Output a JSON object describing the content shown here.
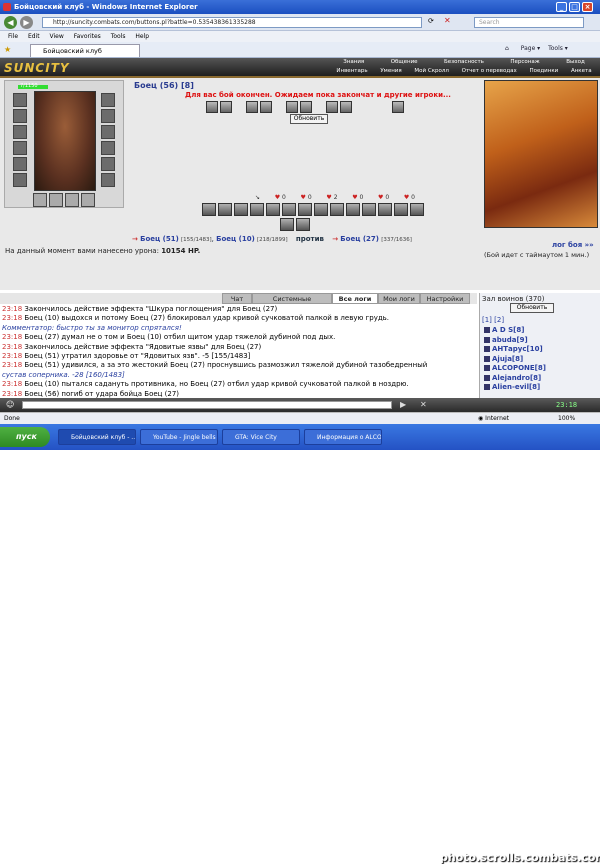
{
  "window": {
    "title": "Бойцовский клуб - Windows Internet Explorer",
    "min": "_",
    "max": "□",
    "close": "×"
  },
  "address": {
    "url": "http://suncity.combats.com/buttons.pl?battle=0.535438361335288",
    "search_placeholder": "Search"
  },
  "menu": [
    "File",
    "Edit",
    "View",
    "Favorites",
    "Tools",
    "Help"
  ],
  "tab": {
    "title": "Бойцовский клуб",
    "page_label": "Page",
    "tools_label": "Tools"
  },
  "game_nav": {
    "top": [
      "Знания",
      "Общение",
      "Безопасность",
      "Персонаж",
      "Выход"
    ],
    "bottom": [
      "Инвентарь",
      "Умения",
      "Мой Скролл",
      "Отчет о переводах",
      "Поединки",
      "Анкета"
    ]
  },
  "logo": "SUNCITY",
  "hero": {
    "hp": "7/1150",
    "name": "Боец (56) [8]"
  },
  "fight": {
    "message": "Для вас бой окончен. Ожидаем пока закончат и другие игроки...",
    "refresh": "Обновить",
    "counters": [
      "0",
      "0",
      "2",
      "0",
      "0",
      "0"
    ]
  },
  "sides": {
    "left": [
      {
        "name": "Боец (51)",
        "hp": "[155/1483]"
      },
      {
        "name": "Боец (10)",
        "hp": "[218/1899]"
      }
    ],
    "vs": "против",
    "right": [
      {
        "name": "Боец (27)",
        "hp": "[337/1636]"
      }
    ]
  },
  "damage": {
    "label": "На данный момент вами нанесено урона:",
    "value": "10154 HP."
  },
  "battle_log_link": "лог боя »»",
  "timeout": "(Бой идет с таймаутом 1 мин.)",
  "log_tabs": [
    "Чат",
    "Системные сообщения",
    "Все логи",
    "Мои логи",
    "Настройки"
  ],
  "log": [
    {
      "t": "23:18",
      "text": "Закончилось действие эффекта \"Шкура поглощения\" для Боец (27)"
    },
    {
      "t": "23:18",
      "text": "Боец (10) выдохся и потому Боец (27) блокировал удар кривой сучковатой палкой в левую грудь."
    },
    {
      "t": "",
      "text": "Комментатор: быстро ты за монитор спрятался!"
    },
    {
      "t": "23:18",
      "text": "Боец (27) думал не о том и Боец (10) отбил щитом удар тяжелой дубиной под дых."
    },
    {
      "t": "23:18",
      "text": "Закончилось действие эффекта \"Ядовитые язвы\" для Боец (27)"
    },
    {
      "t": "23:18",
      "text": "Боец (51) утратил здоровье от \"Ядовитых язв\". -5 [155/1483]"
    },
    {
      "t": "23:18",
      "text": "Боец (51) удивился, а за это жестокий Боец (27) проснувшись размозжил тяжелой дубиной тазобедренный"
    },
    {
      "t": "",
      "text": "сустав соперника. -28 [160/1483]"
    },
    {
      "t": "23:18",
      "text": "Боец (10) пытался садануть противника, но Боец (27) отбил удар кривой сучковатой палкой в ноздрю."
    },
    {
      "t": "23:18",
      "text": "Боец (56) погиб от удара бойца Боец (27)"
    }
  ],
  "right_panel": {
    "title": "Зал воинов (370)",
    "refresh": "Обновить",
    "pages": "[1] [2]",
    "players": [
      "A D S[8]",
      "abuda[9]",
      "АНТарус[10]",
      "Ajuja[8]",
      "ALCOPONE[8]",
      "Alejandro[8]",
      "Alien-evil[8]"
    ]
  },
  "clock": "23:18",
  "status": {
    "left": "Done",
    "zone": "Internet",
    "zoom": "100%"
  },
  "taskbar": {
    "start": "пуск",
    "tasks": [
      "Бойцовский клуб - ...",
      "YouTube - Jingle bells ...",
      "GTA: Vice City",
      "Информация о ALCO..."
    ]
  },
  "watermark": "photo.scrolls.combats.com"
}
